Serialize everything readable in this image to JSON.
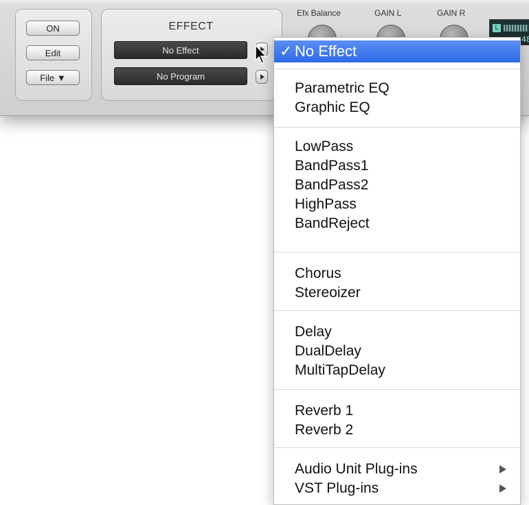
{
  "plugin": {
    "buttons": {
      "on": "ON",
      "edit": "Edit",
      "file": "File ▼"
    },
    "effect_title": "EFFECT",
    "effect_lcd": "No Effect",
    "program_lcd": "No Program",
    "knobs": {
      "balance": "Efx Balance",
      "gain_l": "GAIN L",
      "gain_r": "GAIN R"
    },
    "meter": {
      "channel": "L",
      "value": "48"
    }
  },
  "menu": {
    "selected": {
      "check": "✓",
      "label": "No Effect"
    },
    "groups": [
      [
        "Parametric EQ",
        "Graphic EQ"
      ],
      [
        "LowPass",
        "BandPass1",
        "BandPass2",
        "HighPass",
        "BandReject"
      ],
      [
        "Chorus",
        "Stereoizer"
      ],
      [
        "Delay",
        "DualDelay",
        "MultiTapDelay"
      ],
      [
        "Reverb 1",
        "Reverb 2"
      ],
      [
        "Audio Unit Plug-ins",
        "VST Plug-ins"
      ]
    ]
  }
}
